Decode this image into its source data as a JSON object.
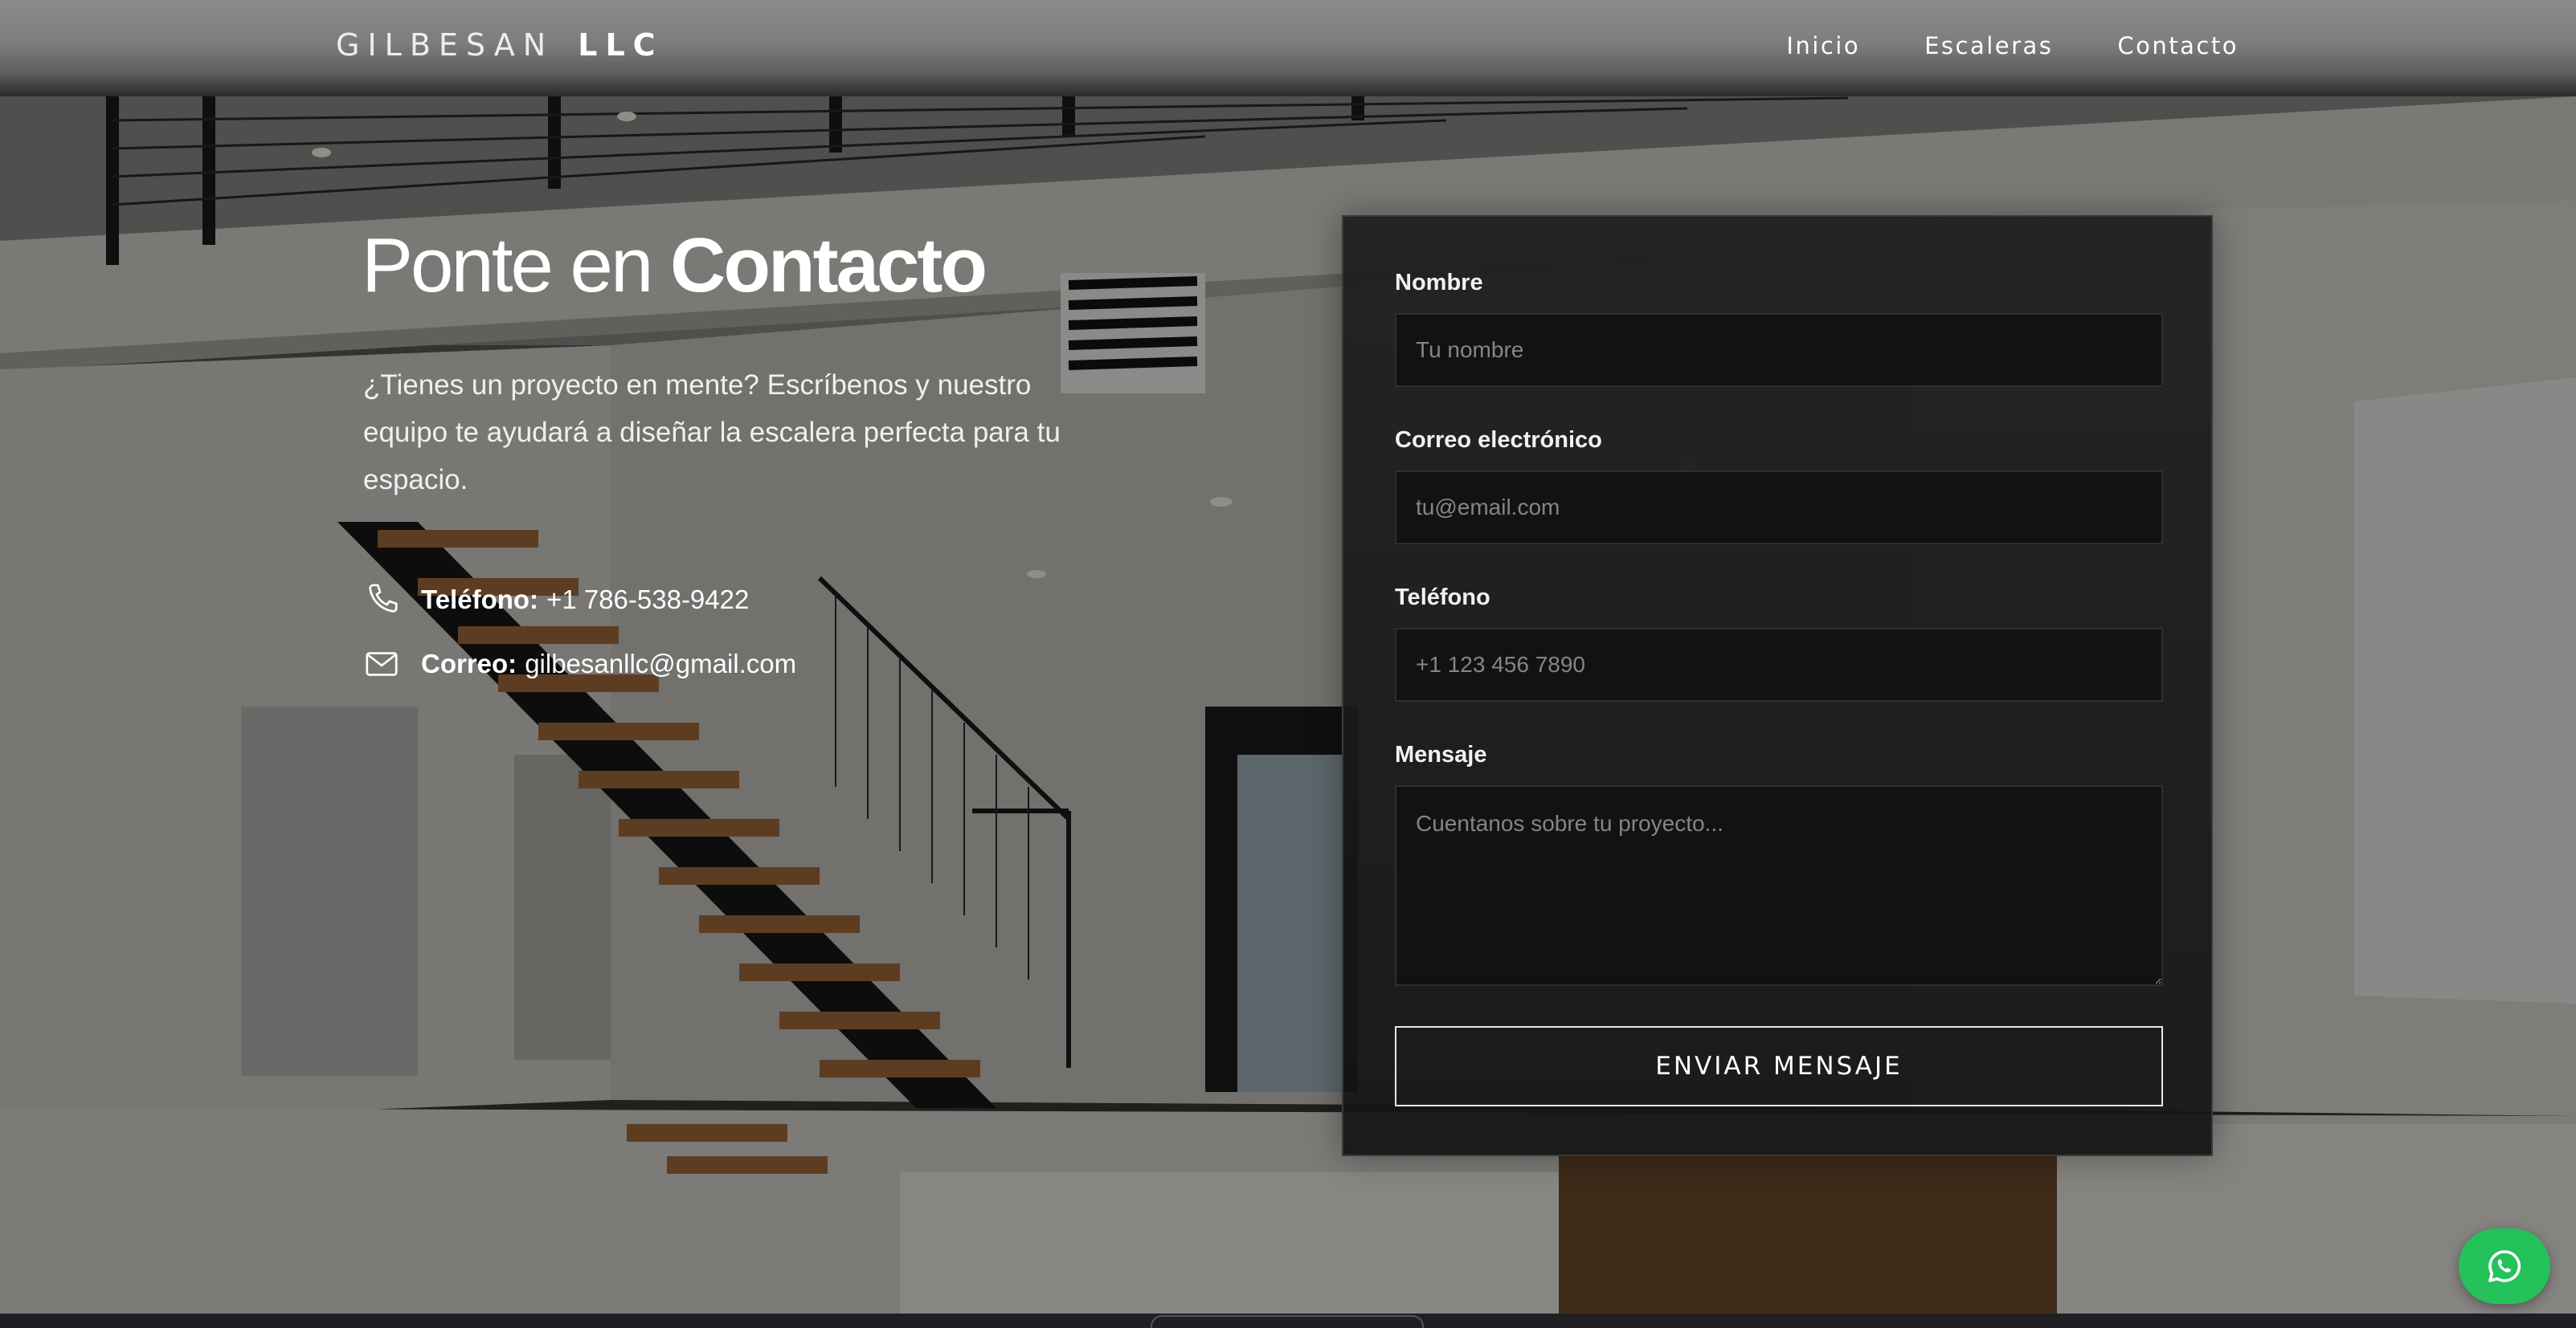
{
  "header": {
    "brand_light": "GILBESAN",
    "brand_bold": "LLC",
    "nav": [
      {
        "label": "Inicio"
      },
      {
        "label": "Escaleras"
      },
      {
        "label": "Contacto"
      }
    ]
  },
  "hero": {
    "heading_light": "Ponte en",
    "heading_bold": "Contacto",
    "intro": "¿Tienes un proyecto en mente? Escríbenos y nuestro equipo te ayudará a diseñar la escalera perfecta para tu espacio.",
    "phone_label": "Teléfono:",
    "phone_value": "+1 786-538-9422",
    "email_label": "Correo:",
    "email_value": "gilbesanllc@gmail.com",
    "phone_icon": "phone-icon",
    "email_icon": "envelope-icon"
  },
  "form": {
    "name_label": "Nombre",
    "name_placeholder": "Tu nombre",
    "email_label": "Correo electrónico",
    "email_placeholder": "tu@email.com",
    "phone_label": "Teléfono",
    "phone_placeholder": "+1 123 456 7890",
    "message_label": "Mensaje",
    "message_placeholder": "Cuentanos sobre tu proyecto...",
    "submit_label": "ENVIAR MENSAJE"
  },
  "floating": {
    "whatsapp_icon": "whatsapp-icon",
    "whatsapp_color": "#25c15a"
  },
  "colors": {
    "text": "#ffffff",
    "card_bg": "#1a1a1a",
    "input_bg": "#121212"
  }
}
